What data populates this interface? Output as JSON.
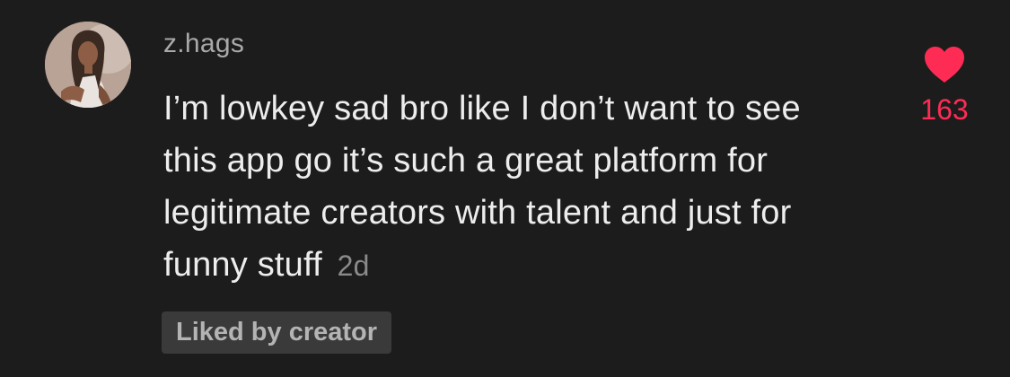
{
  "comment": {
    "username": "z.hags",
    "text": "I’m lowkey sad bro like I don’t want to see this app go it’s such a great platform for legitimate creators with talent and just for funny stuff",
    "timestamp": "2d",
    "badge": "Liked by creator",
    "like_count": "163",
    "like_icon": "heart-icon",
    "avatar_icon": "user-avatar"
  },
  "colors": {
    "background": "#1c1c1c",
    "text": "#ededed",
    "username": "#a9a9a9",
    "timestamp": "#8a8a8a",
    "badge_bg": "#3a3a3a",
    "badge_text": "#b4b4b4",
    "heart": "#fe2c55"
  }
}
